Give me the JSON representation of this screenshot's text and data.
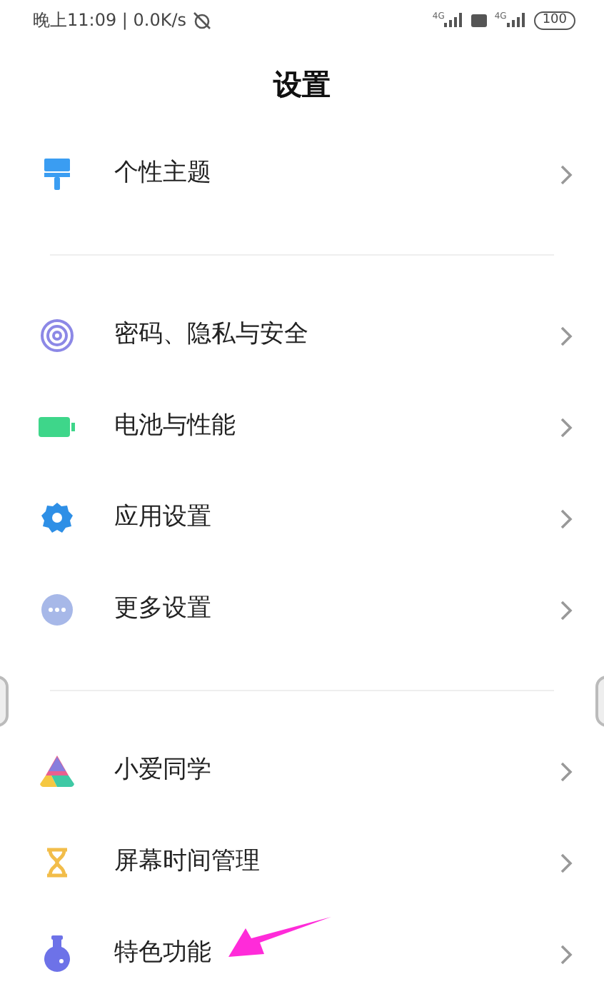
{
  "status_bar": {
    "time": "晚上11:09 | 0.0K/s",
    "sim1": "4G",
    "sim2": "4G",
    "battery": "100"
  },
  "title": "设置",
  "groups": [
    {
      "items": [
        {
          "label": "个性主题",
          "kind": "theme"
        }
      ]
    },
    {
      "items": [
        {
          "label": "密码、隐私与安全",
          "kind": "fingerprint"
        },
        {
          "label": "电池与性能",
          "kind": "battery"
        },
        {
          "label": "应用设置",
          "kind": "gear"
        },
        {
          "label": "更多设置",
          "kind": "more"
        }
      ]
    },
    {
      "items": [
        {
          "label": "小爱同学",
          "kind": "assistant"
        },
        {
          "label": "屏幕时间管理",
          "kind": "hourglass"
        },
        {
          "label": "特色功能",
          "kind": "flask",
          "annotated": true
        }
      ]
    }
  ]
}
